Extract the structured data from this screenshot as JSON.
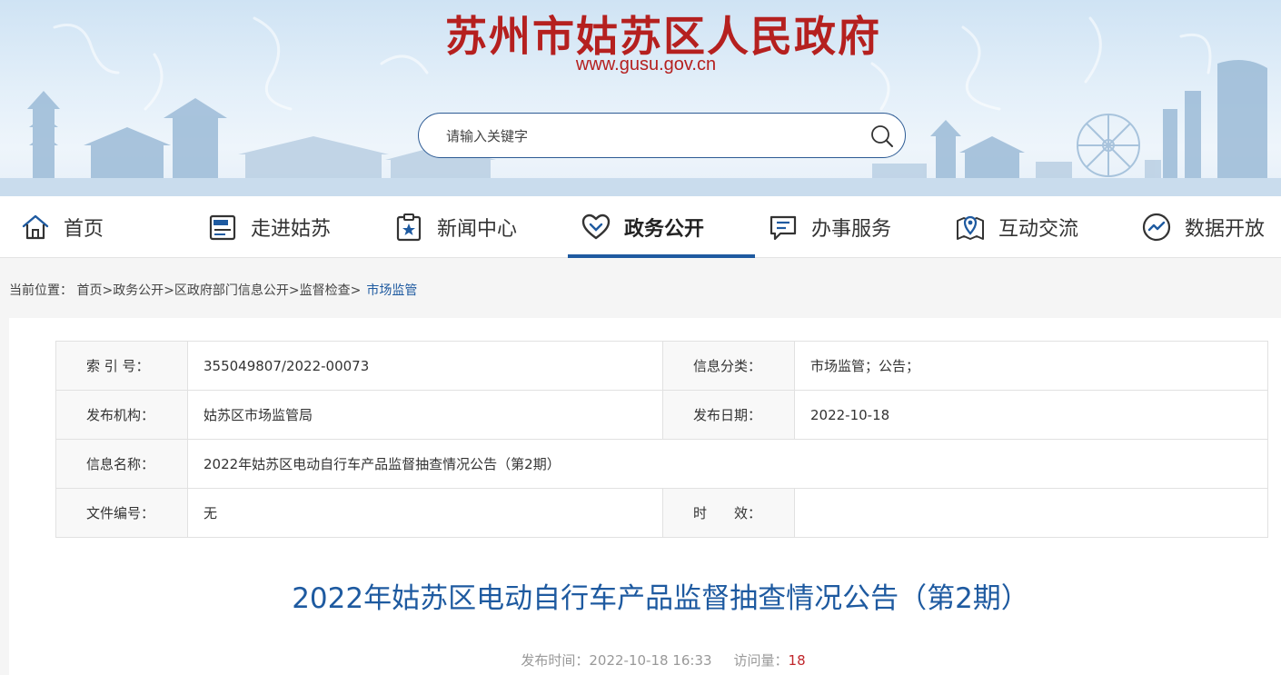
{
  "site": {
    "title": "苏州市姑苏区人民政府",
    "url": "www.gusu.gov.cn"
  },
  "search": {
    "placeholder": "请输入关键字",
    "icon": "search-icon"
  },
  "nav": {
    "items": [
      {
        "label": "首页",
        "icon": "home-icon"
      },
      {
        "label": "走进姑苏",
        "icon": "news-doc-icon"
      },
      {
        "label": "新闻中心",
        "icon": "clipboard-star-icon"
      },
      {
        "label": "政务公开",
        "icon": "heart-icon",
        "active": true
      },
      {
        "label": "办事服务",
        "icon": "chat-list-icon"
      },
      {
        "label": "互动交流",
        "icon": "map-pin-icon"
      },
      {
        "label": "数据开放",
        "icon": "trend-circle-icon"
      }
    ],
    "accent": "#1e5aa0"
  },
  "breadcrumb": {
    "prefix": "当前位置：",
    "items": [
      "首页",
      "政务公开",
      "区政府部门信息公开",
      "监督检查"
    ],
    "current": "市场监管"
  },
  "info_table": {
    "rows": [
      {
        "k1": "索 引 号：",
        "v1": "355049807/2022-00073",
        "k2": "信息分类：",
        "v2": "市场监管；公告；"
      },
      {
        "k1": "发布机构：",
        "v1": "姑苏区市场监管局",
        "k2": "发布日期：",
        "v2": "2022-10-18"
      },
      {
        "k1": "信息名称：",
        "v1": "2022年姑苏区电动自行车产品监督抽查情况公告（第2期）"
      },
      {
        "k1": "文件编号：",
        "v1": "无",
        "k2": "时　　效：",
        "v2": ""
      }
    ]
  },
  "article": {
    "title": "2022年姑苏区电动自行车产品监督抽查情况公告（第2期）",
    "publish_label": "发布时间：",
    "publish_time": "2022-10-18 16:33",
    "views_label": "访问量：",
    "views": "18"
  },
  "colors": {
    "brand_red": "#b5201f",
    "link_blue": "#1e5aa0",
    "count_red": "#c0262b"
  }
}
